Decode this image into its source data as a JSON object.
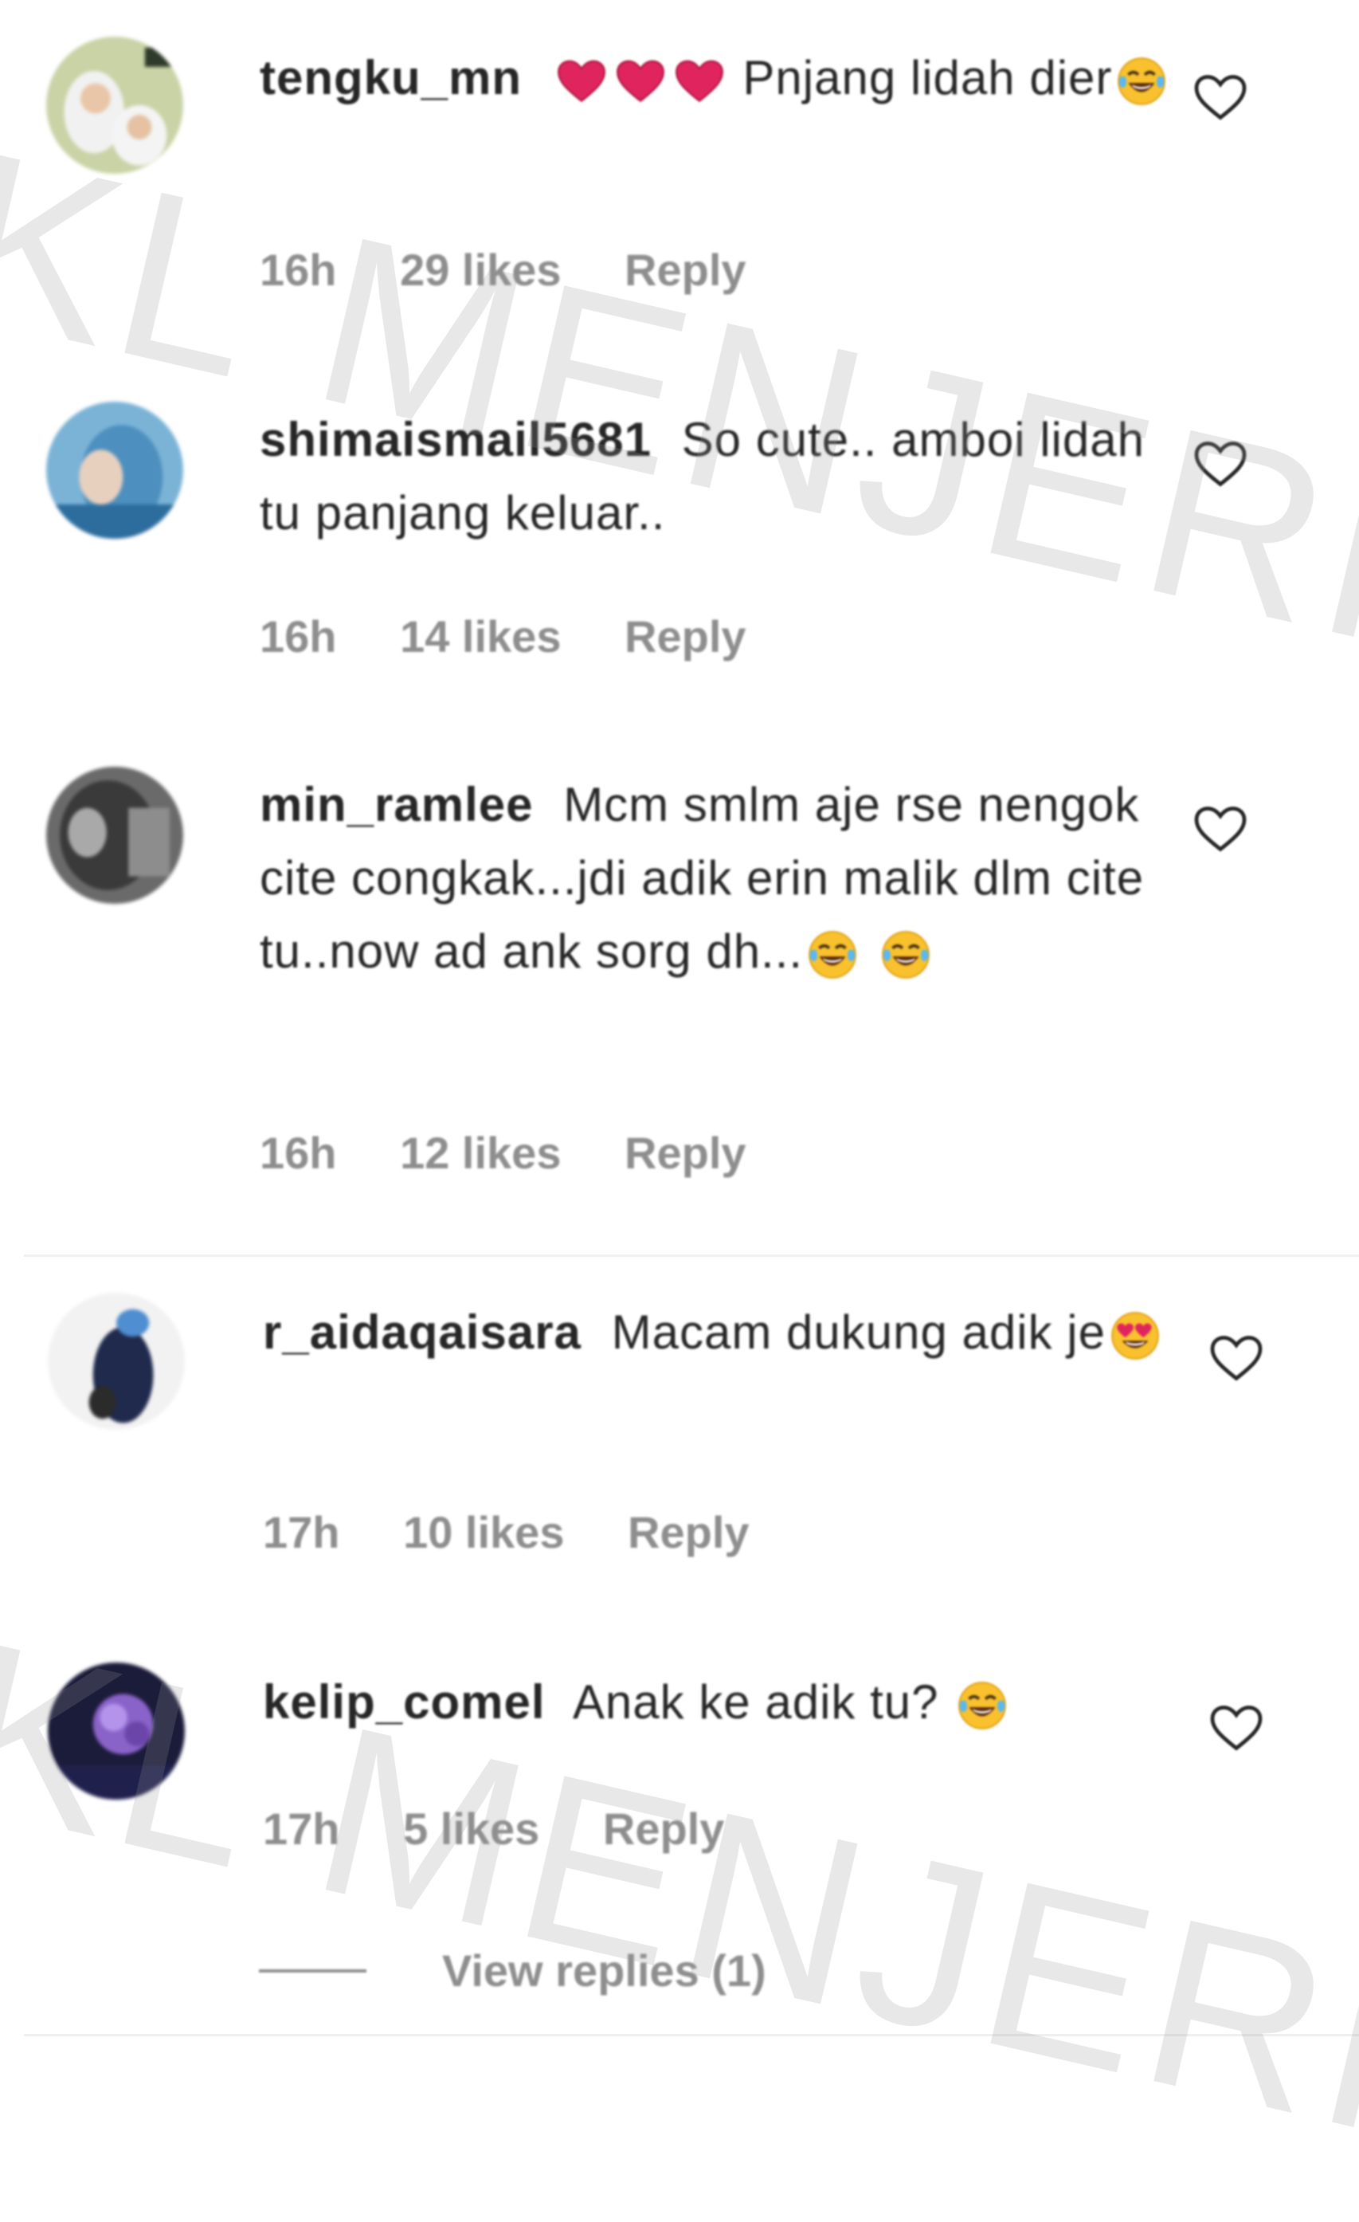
{
  "comments": [
    {
      "username": "tengku_mn",
      "text_before": "❤️❤️❤️ Pnjang lidah dier",
      "emoji": "joy",
      "time": "16h",
      "likes": "29 likes",
      "reply": "Reply"
    },
    {
      "username": "shimaismail5681",
      "text_before": "So cute.. amboi lidah tu panjang keluar..",
      "emoji": "",
      "time": "16h",
      "likes": "14 likes",
      "reply": "Reply"
    },
    {
      "username": "min_ramlee",
      "text_before": "Mcm smlm aje rse nengok cite congkak...jdi adik erin malik dlm cite tu..now ad ank sorg dh...",
      "emoji": "joy-joy",
      "time": "16h",
      "likes": "12 likes",
      "reply": "Reply"
    },
    {
      "username": "r_aidaqaisara",
      "text_before": "Macam dukung adik je",
      "emoji": "heart-eyes",
      "time": "17h",
      "likes": "10 likes",
      "reply": "Reply"
    },
    {
      "username": "kelip_comel",
      "text_before": "Anak ke adik tu?",
      "emoji": "joy",
      "time": "17h",
      "likes": "5 likes",
      "reply": "Reply"
    }
  ],
  "view_replies": "View replies (1)",
  "watermark": "KL MENJERIT",
  "icons": {
    "like": "heart-outline-icon",
    "emoji_joy": "face-with-tears-of-joy-icon",
    "emoji_heart_eyes": "heart-eyes-face-icon"
  },
  "colors": {
    "text": "#262626",
    "meta": "#8e8e8e",
    "heart_red": "#e0245e",
    "emoji_yellow": "#f9c12e"
  }
}
